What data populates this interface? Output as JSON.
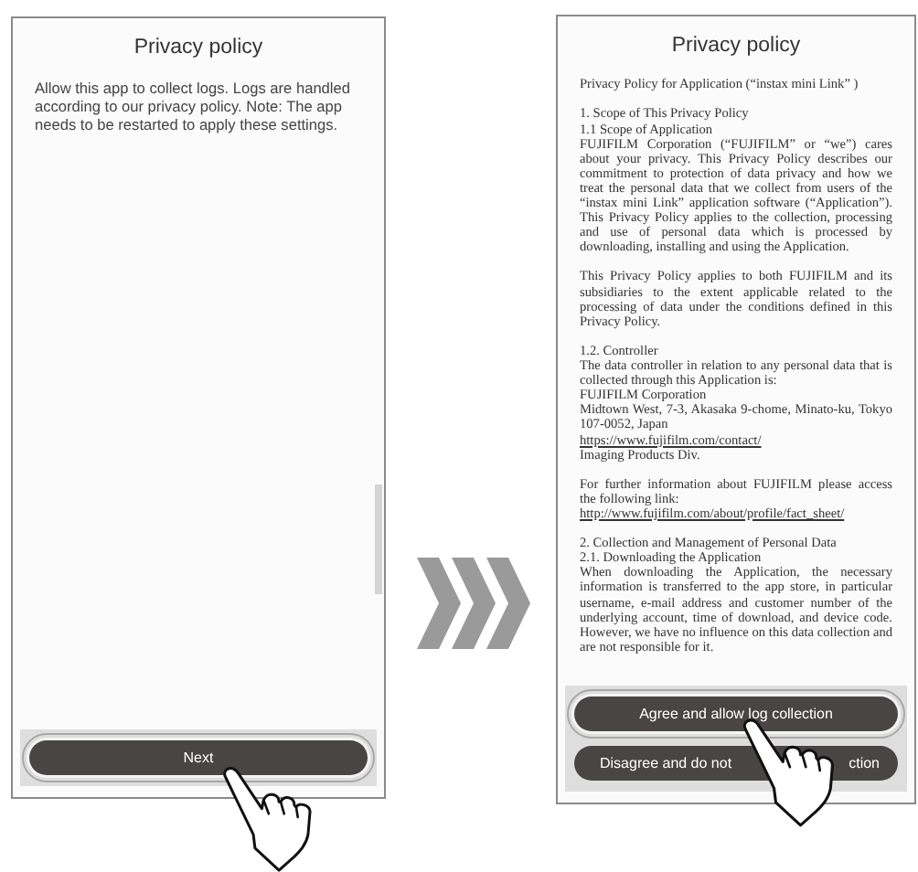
{
  "screens": [
    {
      "title": "Privacy policy",
      "kind": "prompt",
      "body": [
        [
          {
            "kind": "plain",
            "text": "Allow this app to collect logs. Logs are handled according to our privacy policy. Note: The app needs to be restarted to apply these settings."
          }
        ]
      ],
      "buttons": [
        {
          "label_parts": [
            "Next"
          ],
          "highlighted": true
        }
      ]
    },
    {
      "title": "Privacy policy",
      "kind": "policy",
      "body": [
        [
          {
            "kind": "line",
            "text": "Privacy Policy for Application (“instax mini Link” )"
          }
        ],
        [
          {
            "kind": "line",
            "text": "1. Scope of This Privacy Policy"
          },
          {
            "kind": "line",
            "text": "1.1 Scope of Application"
          },
          {
            "kind": "justified",
            "text": "FUJIFILM Corporation (“FUJIFILM” or “we”) cares about your privacy. This Privacy Policy describes our commitment to protection of data privacy and how we treat the personal data that we collect from users of the “instax mini Link” application software (“Application”). This Privacy Policy applies to the collection, processing and use of personal data which is processed by downloading, installing and using the Application."
          }
        ],
        [
          {
            "kind": "justified",
            "text": "This Privacy Policy applies to both FUJIFILM and its subsidiaries to the extent applicable related to the processing of data under the conditions defined in this Privacy Policy."
          }
        ],
        [
          {
            "kind": "line",
            "text": "1.2. Controller"
          },
          {
            "kind": "justified",
            "text": "The data controller in relation to any personal data that is collected through this Application is:"
          },
          {
            "kind": "line",
            "text": "FUJIFILM Corporation"
          },
          {
            "kind": "justified",
            "text": "Midtown West, 7-3, Akasaka 9-chome, Minato-ku, Tokyo 107-0052, Japan"
          },
          {
            "kind": "link",
            "text": "https://www.fujifilm.com/contact/"
          },
          {
            "kind": "line",
            "text": "Imaging Products Div."
          }
        ],
        [
          {
            "kind": "justified",
            "text": "For further information about FUJIFILM please access the following link:"
          },
          {
            "kind": "link",
            "text": "http://www.fujifilm.com/about/profile/fact_sheet/"
          }
        ],
        [
          {
            "kind": "line",
            "text": "2. Collection and Management of Personal Data"
          },
          {
            "kind": "line",
            "text": "2.1. Downloading the Application"
          },
          {
            "kind": "justified",
            "text": "When downloading the Application, the necessary information is transferred to the app store, in particular username, e-mail address and customer number of the underlying account, time of download, and device code. However, we have no influence on this data collection and are not responsible for it."
          }
        ]
      ],
      "buttons": [
        {
          "label_parts": [
            "Agree and allow log collection"
          ],
          "highlighted": true
        },
        {
          "label_parts": [
            "Disagree and do not",
            "ction"
          ],
          "highlighted": false
        }
      ]
    }
  ]
}
